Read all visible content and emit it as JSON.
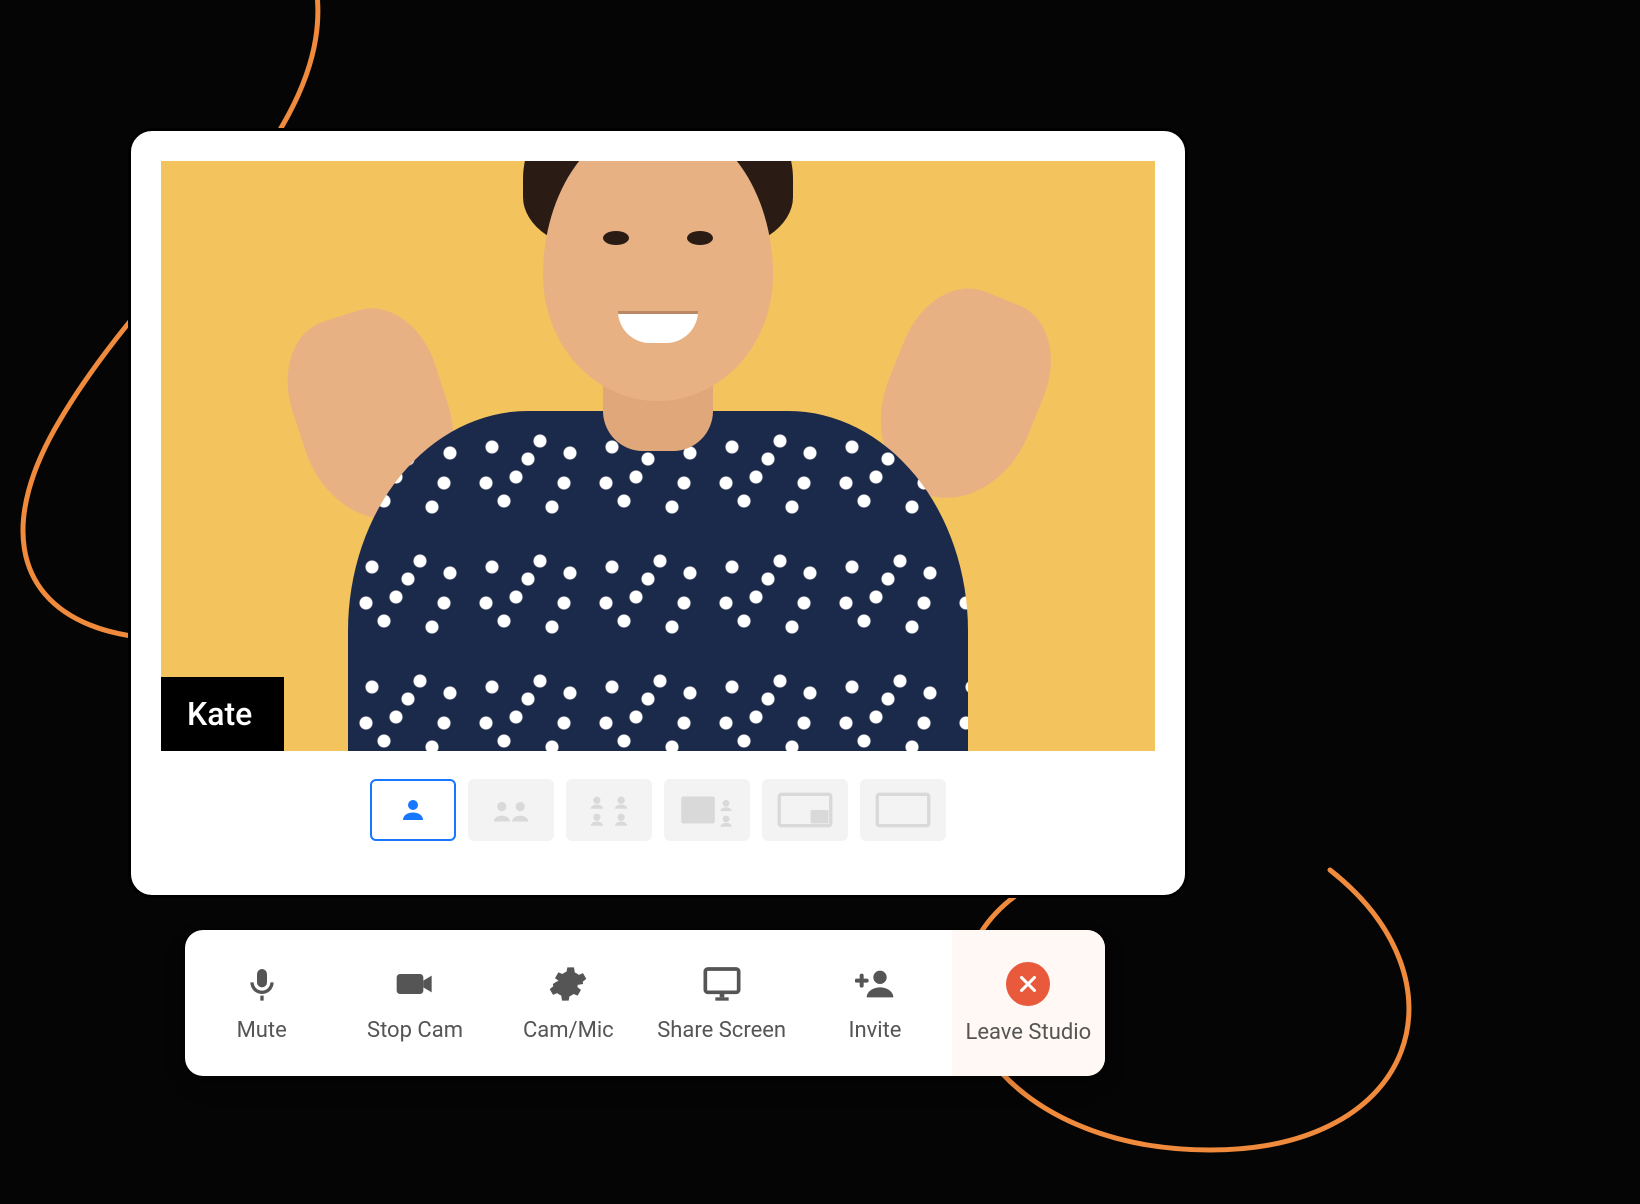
{
  "colors": {
    "stage_bg": "#f3c35e",
    "accent_blue": "#1877ff",
    "leave_red": "#e85a3b",
    "swoosh": "#f08a3c"
  },
  "participant": {
    "name": "Kate"
  },
  "layouts": {
    "active_index": 0,
    "count": 6
  },
  "toolbar": {
    "mute_label": "Mute",
    "stop_cam_label": "Stop Cam",
    "cam_mic_label": "Cam/Mic",
    "share_screen_label": "Share Screen",
    "invite_label": "Invite",
    "leave_label": "Leave Studio"
  }
}
